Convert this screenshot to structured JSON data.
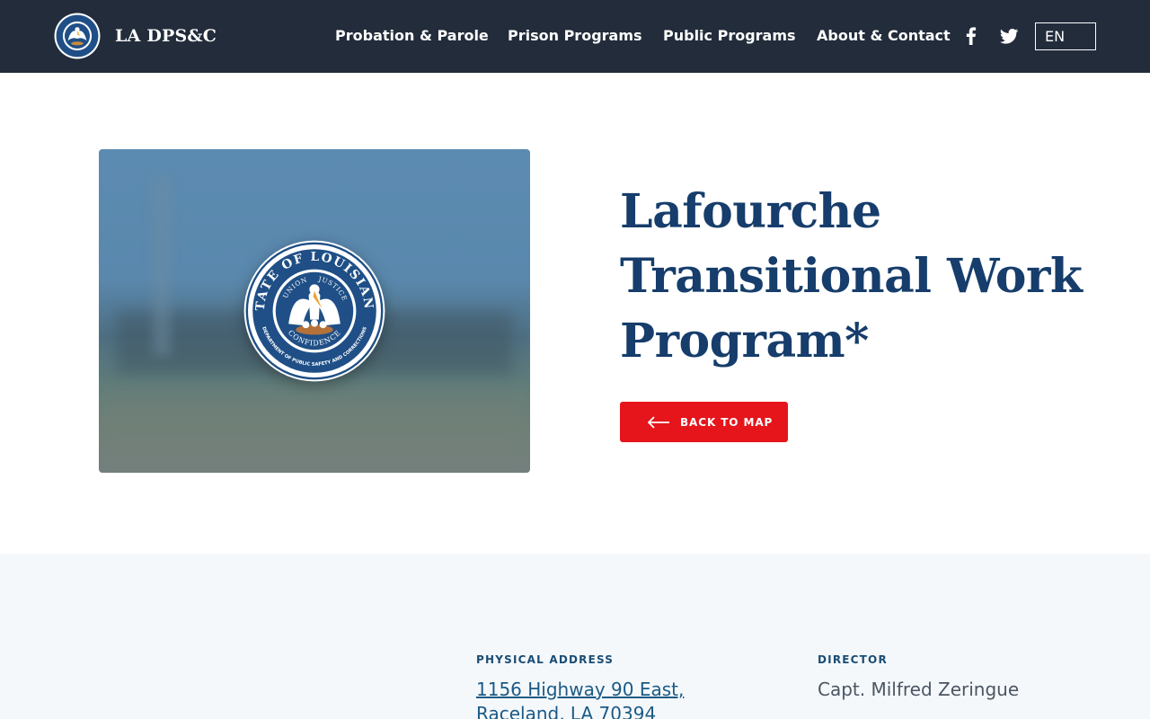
{
  "header": {
    "brand": "LA DPS&C",
    "nav": [
      {
        "label": "Probation & Parole"
      },
      {
        "label": "Prison Programs"
      },
      {
        "label": "Public Programs"
      },
      {
        "label": "About & Contact"
      }
    ],
    "social": [
      "facebook-icon",
      "twitter-icon"
    ],
    "language": "EN"
  },
  "seal": {
    "ring_text": "STATE OF LOUISIANA",
    "motto": [
      "UNION",
      "JUSTICE",
      "CONFIDENCE"
    ],
    "department_text": "DEPARTMENT OF PUBLIC SAFETY AND CORRECTIONS"
  },
  "hero": {
    "title": "Lafourche Transitional Work Program*",
    "back_button": "BACK TO MAP"
  },
  "info": {
    "address_label": "PHYSICAL ADDRESS",
    "address_lines": [
      "1156 Highway 90 East,",
      "Raceland, LA 70394"
    ],
    "director_label": "DIRECTOR",
    "director": "Capt. Milfred Zeringue"
  },
  "colors": {
    "header_bg": "#222c3b",
    "title": "#163d6b",
    "button": "#e5151b",
    "info_bg": "#f5f8fb",
    "link": "#1a5a86"
  }
}
